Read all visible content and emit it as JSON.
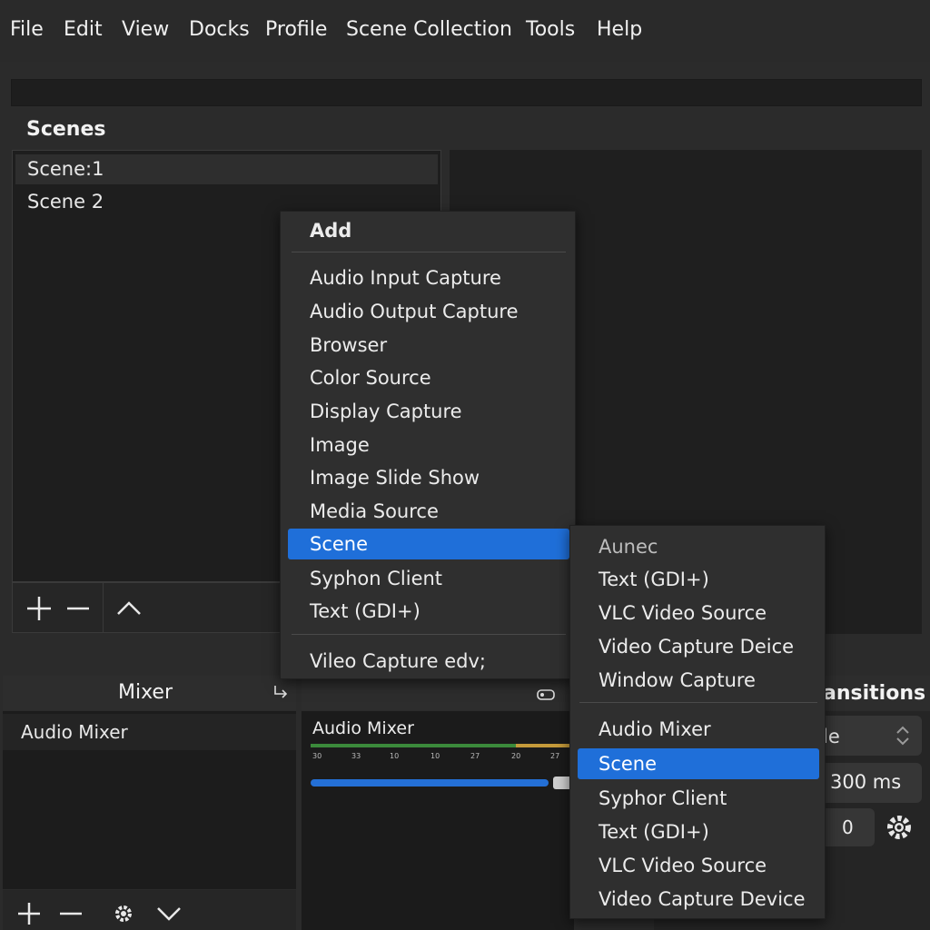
{
  "menubar": {
    "items": [
      "File",
      "Edit",
      "View",
      "Docks",
      "Profile",
      "Scene Collection",
      "Tools",
      "Help"
    ]
  },
  "scenes": {
    "title": "Scenes",
    "items": [
      {
        "label": "Scene:1",
        "selected": true
      },
      {
        "label": "Scene 2",
        "selected": false
      }
    ],
    "toolbar": {
      "add": "+",
      "remove": "−",
      "up": "^"
    }
  },
  "mixer": {
    "title": "Mixer",
    "items": [
      "Audio Mixer"
    ],
    "toolbar": {
      "add": "+",
      "remove": "−"
    }
  },
  "audio_panel": {
    "title": "Audio Mixer",
    "ticks": [
      "30",
      "33",
      "10",
      "10",
      "27",
      "20",
      "27"
    ],
    "volume_level": 0.89,
    "colors": {
      "meter_green": "#3b8a3b",
      "meter_yellow": "#c59a3a",
      "volume": "#2470d6"
    }
  },
  "transitions": {
    "title": "ansitions",
    "select_value": "le",
    "duration": "300 ms",
    "count": "0"
  },
  "add_menu": {
    "header": "Add",
    "items": [
      "Audio Input Capture",
      "Audio Output Capture",
      "Browser",
      "Color Source",
      "Display Capture",
      "Image",
      "Image Slide Show",
      "Media Source",
      "Scene",
      "Syphon Client",
      "Text (GDI+)"
    ],
    "highlighted": "Scene",
    "footer_item": "Vileo Capture edv;",
    "accent": "#1f6fd9"
  },
  "sub_menu": {
    "group1": [
      "Aunec",
      "Text (GDI+)",
      "VLC Video Source",
      "Video Capture Deice",
      "Window Capture"
    ],
    "group2": [
      "Audio Mixer",
      "Scene",
      "Syphor Client",
      "Text (GDI+)",
      "VLC Video Source",
      "Video Capture Device"
    ],
    "highlighted": "Scene"
  }
}
